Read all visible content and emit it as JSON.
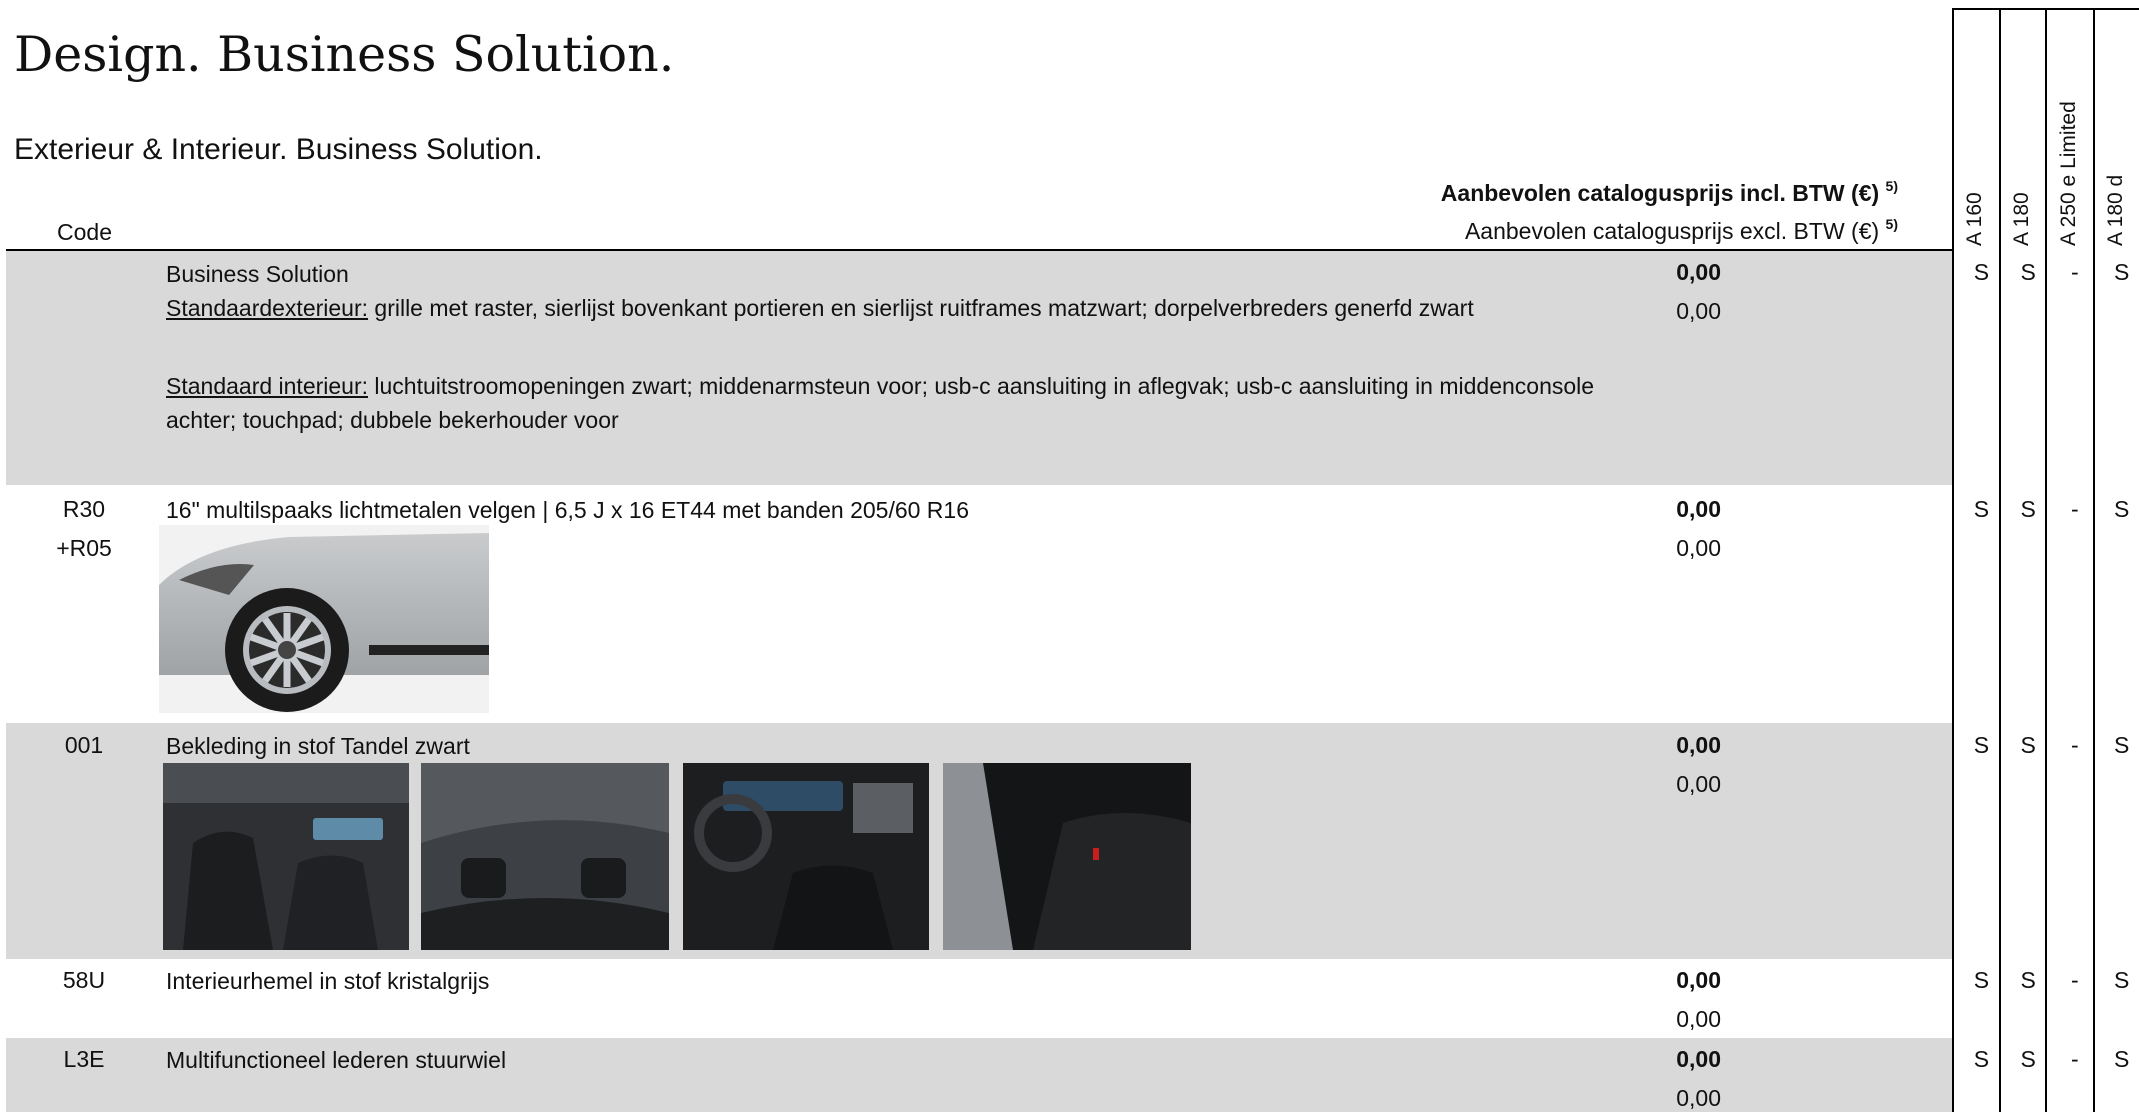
{
  "title": "Design. Business Solution.",
  "section": "Exterieur & Interieur. Business Solution.",
  "header": {
    "code_label": "Code",
    "price_incl_label": "Aanbevolen catalogusprijs incl. BTW (€)",
    "price_excl_label": "Aanbevolen catalogusprijs excl. BTW (€)",
    "footnote": "5)"
  },
  "models": [
    "A 160",
    "A 180",
    "A 250 e Limited",
    "A 180 d"
  ],
  "rows": [
    {
      "codes": [
        ""
      ],
      "description": "Business Solution",
      "exterior_label": "Standaardexterieur:",
      "exterior_text": " grille met raster, sierlijst bovenkant portieren en sierlijst ruitframes matzwart; dorpelverbreders generfd zwart",
      "interior_label": "Standaard interieur:",
      "interior_text": " luchtuitstroomopeningen zwart; middenarmsteun voor; usb-c aansluiting in aflegvak; usb-c aansluiting in middenconsole achter; touchpad; dubbele bekerhouder voor",
      "price_incl": "0,00",
      "price_excl": "0,00",
      "availability": [
        "S",
        "S",
        "-",
        "S"
      ]
    },
    {
      "codes": [
        "R30",
        "+R05"
      ],
      "description": "16\" multilspaaks lichtmetalen velgen | 6,5 J x 16 ET44 met banden 205/60 R16",
      "price_incl": "0,00",
      "price_excl": "0,00",
      "availability": [
        "S",
        "S",
        "-",
        "S"
      ]
    },
    {
      "codes": [
        "001"
      ],
      "description": "Bekleding in stof Tandel zwart",
      "price_incl": "0,00",
      "price_excl": "0,00",
      "availability": [
        "S",
        "S",
        "-",
        "S"
      ]
    },
    {
      "codes": [
        "58U"
      ],
      "description": "Interieurhemel in stof kristalgrijs",
      "price_incl": "0,00",
      "price_excl": "0,00",
      "availability": [
        "S",
        "S",
        "-",
        "S"
      ]
    },
    {
      "codes": [
        "L3E"
      ],
      "description": "Multifunctioneel lederen stuurwiel",
      "price_incl": "0,00",
      "price_excl": "0,00",
      "availability": [
        "S",
        "S",
        "-",
        "S"
      ]
    }
  ],
  "colors": {
    "shaded_row": "#d9d9d9",
    "rule": "#000000"
  }
}
